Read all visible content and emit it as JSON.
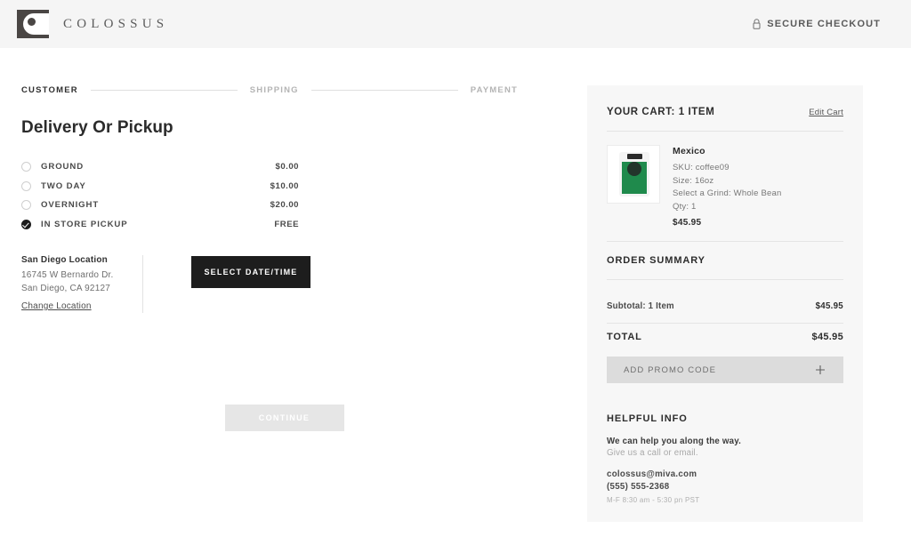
{
  "header": {
    "brand_name": "COLOSSUS",
    "brand_mark_icon": "colossus-logo-mark",
    "secure_label": "SECURE CHECKOUT",
    "lock_icon": "lock-icon",
    "background": "#f5f5f5"
  },
  "steps": [
    {
      "label": "CUSTOMER",
      "active": true
    },
    {
      "label": "SHIPPING",
      "active": false
    },
    {
      "label": "PAYMENT",
      "active": false
    }
  ],
  "main": {
    "title": "Delivery Or Pickup",
    "options": [
      {
        "label": "GROUND",
        "price": "$0.00",
        "selected": false
      },
      {
        "label": "TWO DAY",
        "price": "$10.00",
        "selected": false
      },
      {
        "label": "OVERNIGHT",
        "price": "$20.00",
        "selected": false
      },
      {
        "label": "IN STORE PICKUP",
        "price": "FREE",
        "selected": true
      }
    ],
    "location": {
      "name": "San Diego Location",
      "street": "16745 W Bernardo Dr.",
      "city_state_zip": "San Diego, CA 92127",
      "change_link": "Change Location"
    },
    "select_datetime_label": "SELECT DATE/TIME",
    "continue_label": "CONTINUE"
  },
  "sidebar": {
    "cart_title": "YOUR CART: 1 ITEM",
    "edit_cart_label": "Edit Cart",
    "product": {
      "name": "Mexico",
      "sku": "SKU: coffee09",
      "size": "Size: 16oz",
      "grind": "Select a Grind: Whole Bean",
      "qty": "Qty: 1",
      "price": "$45.95",
      "image_icon": "coffee-bag-image"
    },
    "order_summary": {
      "title": "ORDER SUMMARY",
      "subtotal_label": "Subtotal: 1 Item",
      "subtotal_value": "$45.95",
      "total_label": "TOTAL",
      "total_value": "$45.95",
      "promo_label": "ADD PROMO CODE",
      "promo_icon": "plus-icon"
    },
    "helpful_info": {
      "title": "HELPFUL INFO",
      "lead": "We can help you along the way.",
      "sub": "Give us a call or email.",
      "email": "colossus@miva.com",
      "phone": "(555) 555-2368",
      "hours": "M-F 8:30 am - 5:30 pn PST"
    },
    "background": "#f7f7f7"
  }
}
